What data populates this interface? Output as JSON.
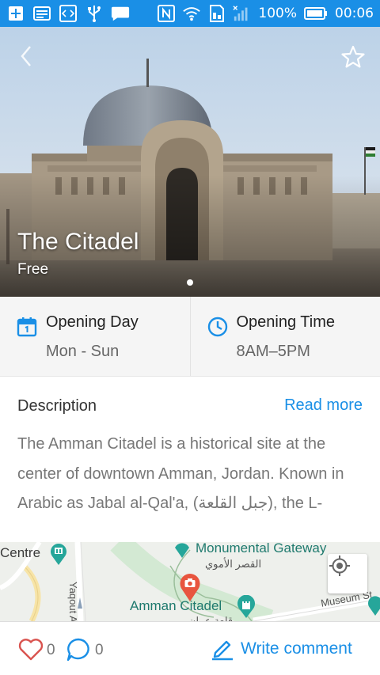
{
  "status_bar": {
    "battery": "100%",
    "time": "00:06",
    "left_icons": [
      "add-icon",
      "image-icon",
      "code-icon",
      "usb-icon",
      "chat-icon"
    ],
    "right_icons": [
      "nfc-icon",
      "wifi-icon",
      "sim-icon",
      "signal-icon",
      "battery-icon"
    ]
  },
  "hero": {
    "title": "The Citadel",
    "subtitle": "Free",
    "page_indicator": {
      "current": 1,
      "total": 1
    }
  },
  "info": {
    "opening_day": {
      "label": "Opening Day",
      "value": "Mon - Sun",
      "icon": "calendar-icon"
    },
    "opening_time": {
      "label": "Opening Time",
      "value": "8AM–5PM",
      "icon": "clock-icon"
    }
  },
  "description": {
    "heading": "Description",
    "read_more": "Read more",
    "text": "The Amman Citadel is a historical site at the center of downtown Amman, Jordan. Known in Arabic as Jabal al-Qal'a, (جبل القلعة), the L-"
  },
  "map": {
    "labels": {
      "centre": "Centre",
      "monumental_gateway": "Monumental Gateway",
      "monumental_gateway_ar": "القصر الأموي",
      "amman_citadel": "Amman Citadel",
      "amman_citadel_ar": "قلعة عمان",
      "yaqout_street": "Yaqout Al-Har",
      "museum_street": "Museum St"
    }
  },
  "bottom_bar": {
    "likes": "0",
    "comments": "0",
    "write_comment": "Write comment"
  },
  "colors": {
    "accent": "#1a8fe6",
    "like_red": "#d9534f",
    "map_marker": "#e8553f",
    "map_poi_teal": "#26a69a"
  }
}
